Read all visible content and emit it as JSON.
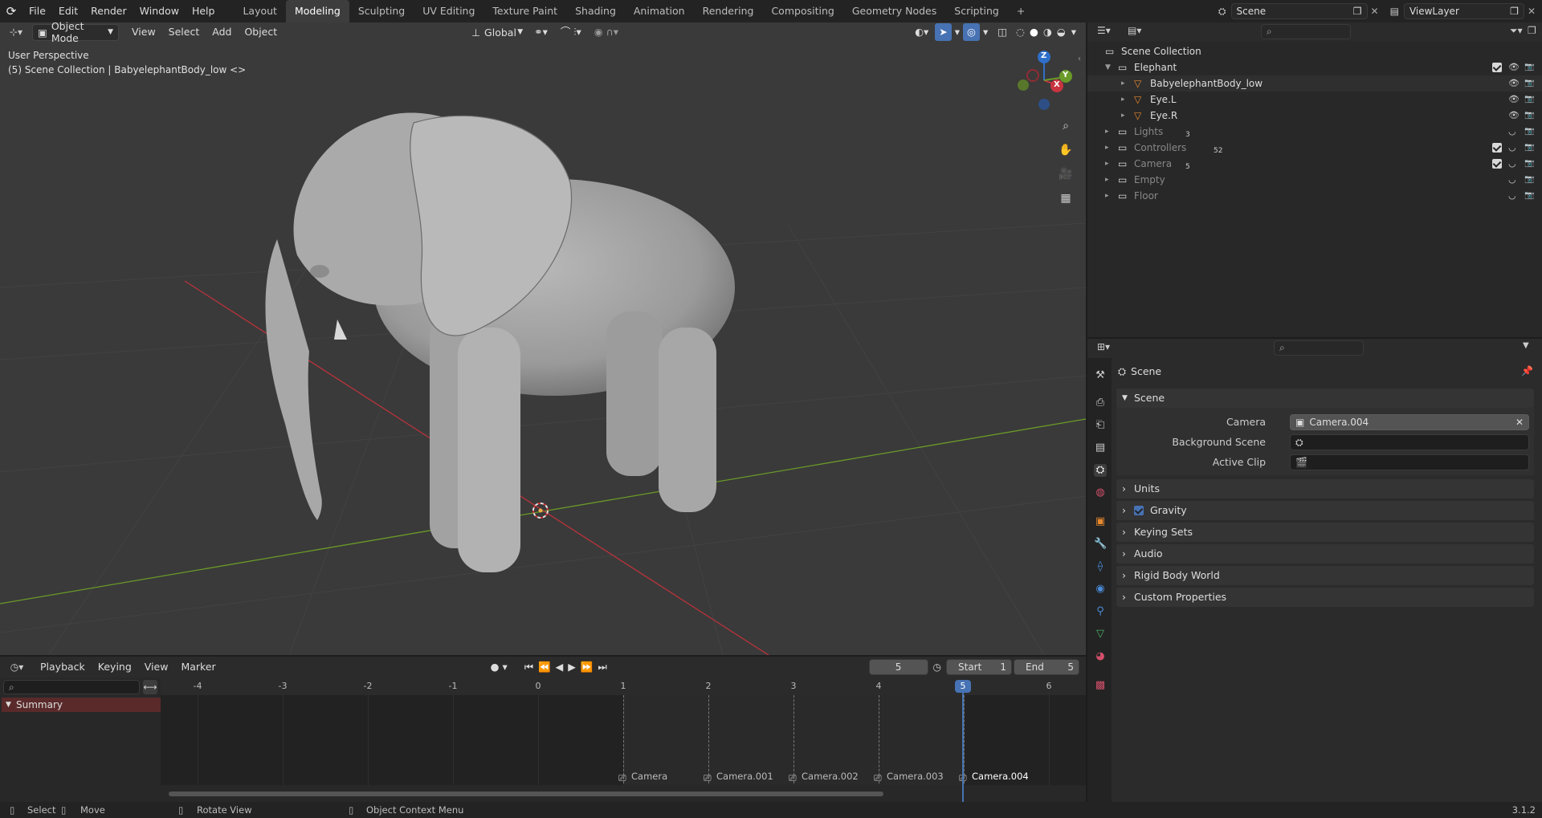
{
  "menus": [
    "File",
    "Edit",
    "Render",
    "Window",
    "Help"
  ],
  "workspace_tabs": [
    {
      "label": "Layout",
      "active": false
    },
    {
      "label": "Modeling",
      "active": true
    },
    {
      "label": "Sculpting",
      "active": false
    },
    {
      "label": "UV Editing",
      "active": false
    },
    {
      "label": "Texture Paint",
      "active": false
    },
    {
      "label": "Shading",
      "active": false
    },
    {
      "label": "Animation",
      "active": false
    },
    {
      "label": "Rendering",
      "active": false
    },
    {
      "label": "Compositing",
      "active": false
    },
    {
      "label": "Geometry Nodes",
      "active": false
    },
    {
      "label": "Scripting",
      "active": false
    }
  ],
  "add_workspace": "+",
  "scene_selector": "Scene",
  "view_layer": "ViewLayer",
  "viewport": {
    "mode": "Object Mode",
    "menus": [
      "View",
      "Select",
      "Add",
      "Object"
    ],
    "orientation": "Global",
    "info_line1": "User Perspective",
    "info_line2": "(5) Scene Collection | BabyelephantBody_low <>",
    "gizmo": {
      "x": "X",
      "y": "Y",
      "z": "Z"
    }
  },
  "outliner": {
    "root": "Scene Collection",
    "items": [
      {
        "label": "Elephant",
        "level": 0,
        "badge": ""
      },
      {
        "label": "BabyelephantBody_low",
        "level": 1,
        "badge": ""
      },
      {
        "label": "Eye.L",
        "level": 1,
        "badge": ""
      },
      {
        "label": "Eye.R",
        "level": 1,
        "badge": ""
      },
      {
        "label": "Lights",
        "level": 0,
        "badge": "3"
      },
      {
        "label": "Controllers",
        "level": 0,
        "badge": "52"
      },
      {
        "label": "Camera",
        "level": 0,
        "badge": "5"
      },
      {
        "label": "Empty",
        "level": 0,
        "badge": ""
      },
      {
        "label": "Floor",
        "level": 0,
        "badge": ""
      }
    ]
  },
  "properties": {
    "breadcrumb": "Scene",
    "section": "Scene",
    "fields": [
      {
        "label": "Camera",
        "value": "Camera.004"
      },
      {
        "label": "Background Scene",
        "value": ""
      },
      {
        "label": "Active Clip",
        "value": ""
      }
    ],
    "panels": [
      "Units",
      "Gravity",
      "Keying Sets",
      "Audio",
      "Rigid Body World",
      "Custom Properties"
    ]
  },
  "timeline": {
    "menus": [
      "Playback",
      "Keying",
      "View",
      "Marker"
    ],
    "current_frame": "5",
    "start_label": "Start",
    "start": "1",
    "end_label": "End",
    "end": "5",
    "summary": "Summary",
    "ruler": [
      "-4",
      "-3",
      "-2",
      "-1",
      "0",
      "1",
      "2",
      "3",
      "4",
      "5",
      "6"
    ],
    "markers": [
      "Camera",
      "Camera.001",
      "Camera.002",
      "Camera.003",
      "Camera.004"
    ]
  },
  "status": {
    "select": "Select",
    "move": "Move",
    "rotate": "Rotate View",
    "context": "Object Context Menu",
    "version": "3.1.2"
  },
  "colors": {
    "accent": "#4772b3",
    "x_axis": "#c8343f",
    "y_axis": "#6a9a28",
    "z_axis": "#2e6fc9"
  }
}
